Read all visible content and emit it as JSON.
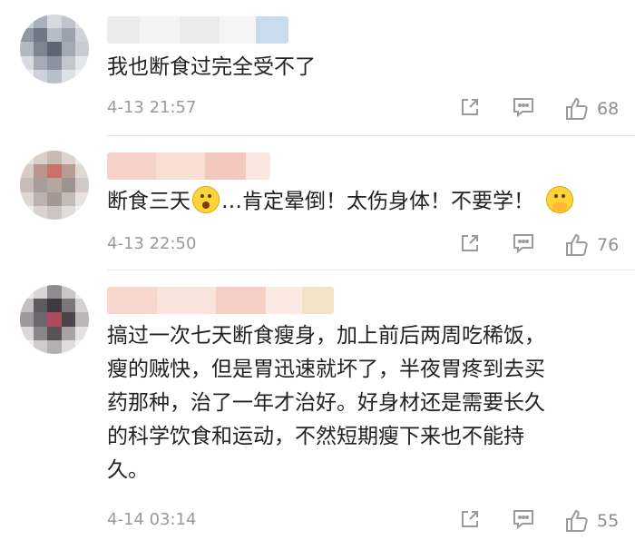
{
  "comments": [
    {
      "text": "我也断食过完全受不了",
      "time": "4-13 21:57",
      "likes": "68"
    },
    {
      "text_part1": "断食三天",
      "text_part2": "…肯定晕倒！太伤身体！不要学！",
      "time": "4-13 22:50",
      "likes": "76"
    },
    {
      "text": "搞过一次七天断食瘦身，加上前后两周吃稀饭，\n瘦的贼快，但是胃迅速就坏了，半夜胃疼到去买\n药那种，治了一年才治好。好身材还是需要长久\n的科学饮食和运动，不然短期瘦下来也不能持\n久。",
      "time": "4-14 03:14",
      "likes": "55"
    }
  ],
  "icons": {
    "share": "share-icon",
    "reply": "comment-icon",
    "like": "thumbs-up-icon"
  },
  "colors": {
    "meta": "#9a9a9a",
    "text": "#222222",
    "divider": "#e6e6e6"
  }
}
